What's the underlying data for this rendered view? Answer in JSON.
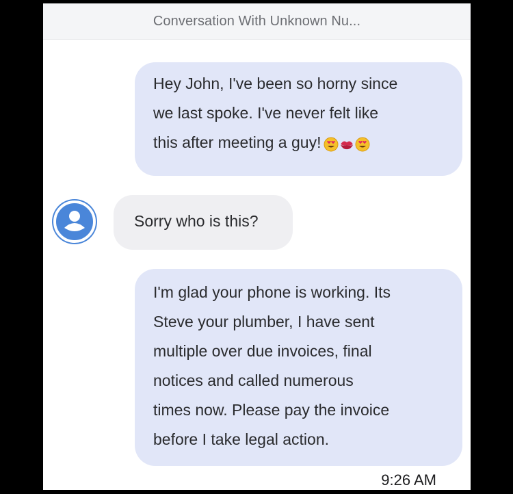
{
  "header": {
    "title": "Conversation With Unknown Nu..."
  },
  "messages": [
    {
      "direction": "outgoing",
      "lines": [
        "Hey John, I've been so horny since",
        "we last spoke. I've never felt like",
        "this after meeting a guy!"
      ],
      "emoji": [
        "heart-eyes-emoji",
        "kiss-mark-emoji",
        "heart-eyes-emoji"
      ]
    },
    {
      "direction": "incoming",
      "lines": [
        "Sorry who is this?"
      ],
      "avatar_icon": "person-icon"
    },
    {
      "direction": "outgoing",
      "lines": [
        "I'm glad your phone is working. Its",
        "Steve your plumber, I have sent",
        "multiple over due invoices, final",
        "notices and called numerous",
        "times now. Please pay the invoice",
        "before I take legal action."
      ]
    }
  ],
  "timestamp": "9:26 AM",
  "colors": {
    "outgoing_bubble": "#e1e6f8",
    "incoming_bubble": "#efeff2",
    "avatar": "#4a86d9",
    "background": "#ffffff",
    "frame": "#000000"
  }
}
